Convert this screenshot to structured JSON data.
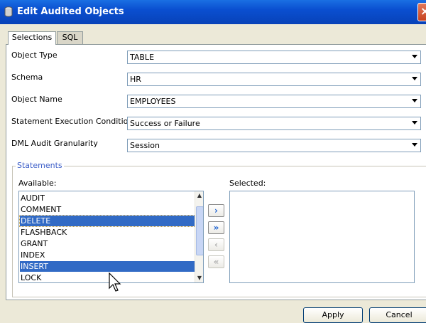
{
  "window": {
    "title": "Edit Audited Objects",
    "close_glyph": "×"
  },
  "tabs": [
    {
      "label": "Selections",
      "active": true
    },
    {
      "label": "SQL",
      "active": false
    }
  ],
  "form": {
    "object_type": {
      "label": "Object Type",
      "value": "TABLE"
    },
    "schema": {
      "label": "Schema",
      "value": "HR"
    },
    "object_name": {
      "label": "Object Name",
      "value": "EMPLOYEES"
    },
    "condition": {
      "label": "Statement Execution Condition",
      "value": "Success or Failure"
    },
    "granularity": {
      "label": "DML Audit Granularity",
      "value": "Session"
    }
  },
  "statements": {
    "group_label": "Statements",
    "available_label": "Available:",
    "selected_label": "Selected:",
    "available": [
      {
        "text": "AUDIT",
        "selected": false
      },
      {
        "text": "COMMENT",
        "selected": false
      },
      {
        "text": "DELETE",
        "selected": true
      },
      {
        "text": "FLASHBACK",
        "selected": false
      },
      {
        "text": "GRANT",
        "selected": false
      },
      {
        "text": "INDEX",
        "selected": false
      },
      {
        "text": "INSERT",
        "selected": true
      },
      {
        "text": "LOCK",
        "selected": false
      }
    ],
    "buttons": {
      "move": "›",
      "move_all": "»",
      "remove": "‹",
      "remove_all": "«"
    }
  },
  "footer": {
    "apply": "Apply",
    "cancel": "Cancel"
  },
  "colors": {
    "selection": "#316ac5",
    "titlebar": "#0a4fd0",
    "legend": "#3c5ec8"
  }
}
